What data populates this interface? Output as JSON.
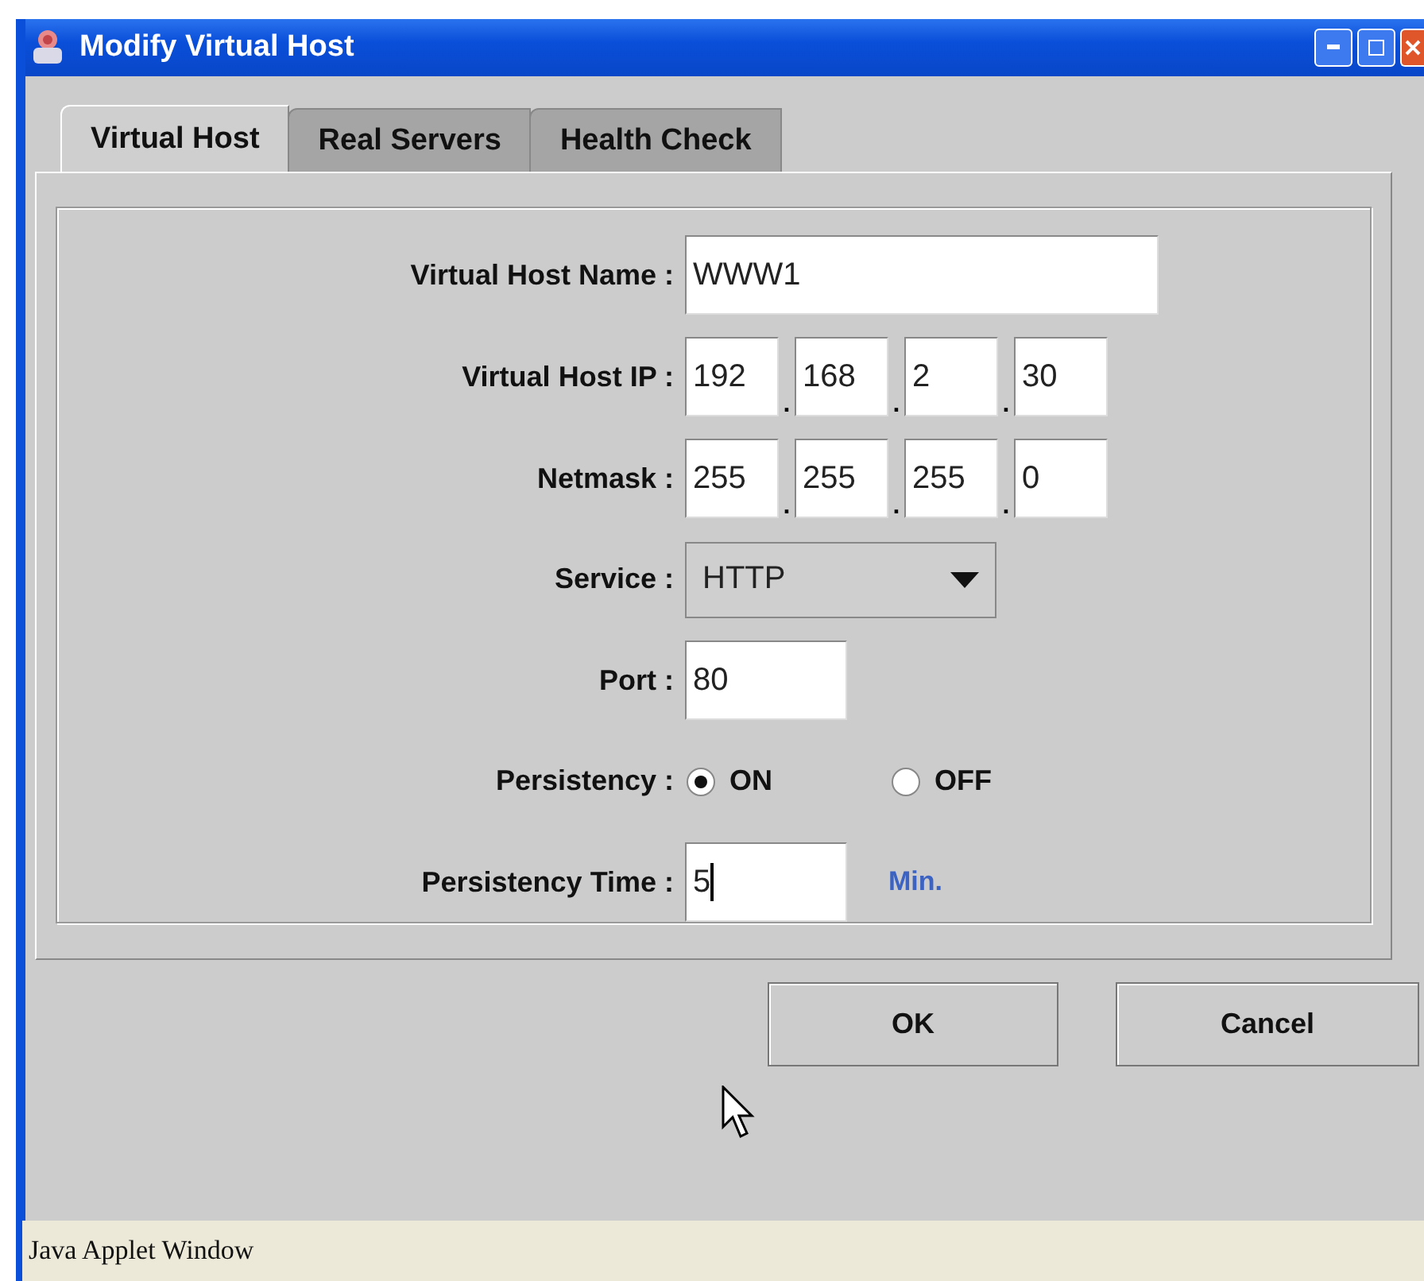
{
  "window": {
    "title": "Modify Virtual Host"
  },
  "tabs": [
    {
      "label": "Virtual Host",
      "selected": true
    },
    {
      "label": "Real Servers",
      "selected": false
    },
    {
      "label": "Health Check",
      "selected": false
    }
  ],
  "form": [
    {
      "kind": "text",
      "label": "Virtual Host Name :",
      "value": "WWW1"
    },
    {
      "kind": "ip",
      "label": "Virtual Host IP :",
      "octets": [
        "192",
        "168",
        "2",
        "30"
      ],
      "separator": "."
    },
    {
      "kind": "ip",
      "label": "Netmask :",
      "octets": [
        "255",
        "255",
        "255",
        "0"
      ],
      "separator": "."
    },
    {
      "kind": "select",
      "label": "Service :",
      "value": "HTTP"
    },
    {
      "kind": "short",
      "label": "Port :",
      "value": "80",
      "focused": false
    },
    {
      "kind": "radio",
      "label": "Persistency :",
      "options": [
        {
          "label": "ON",
          "selected": true
        },
        {
          "label": "OFF",
          "selected": false
        }
      ]
    },
    {
      "kind": "short",
      "label": "Persistency Time :",
      "value": "5",
      "unit": "Min.",
      "focused": true
    }
  ],
  "buttons": [
    "OK",
    "Cancel"
  ],
  "status_bar": "Java Applet Window"
}
